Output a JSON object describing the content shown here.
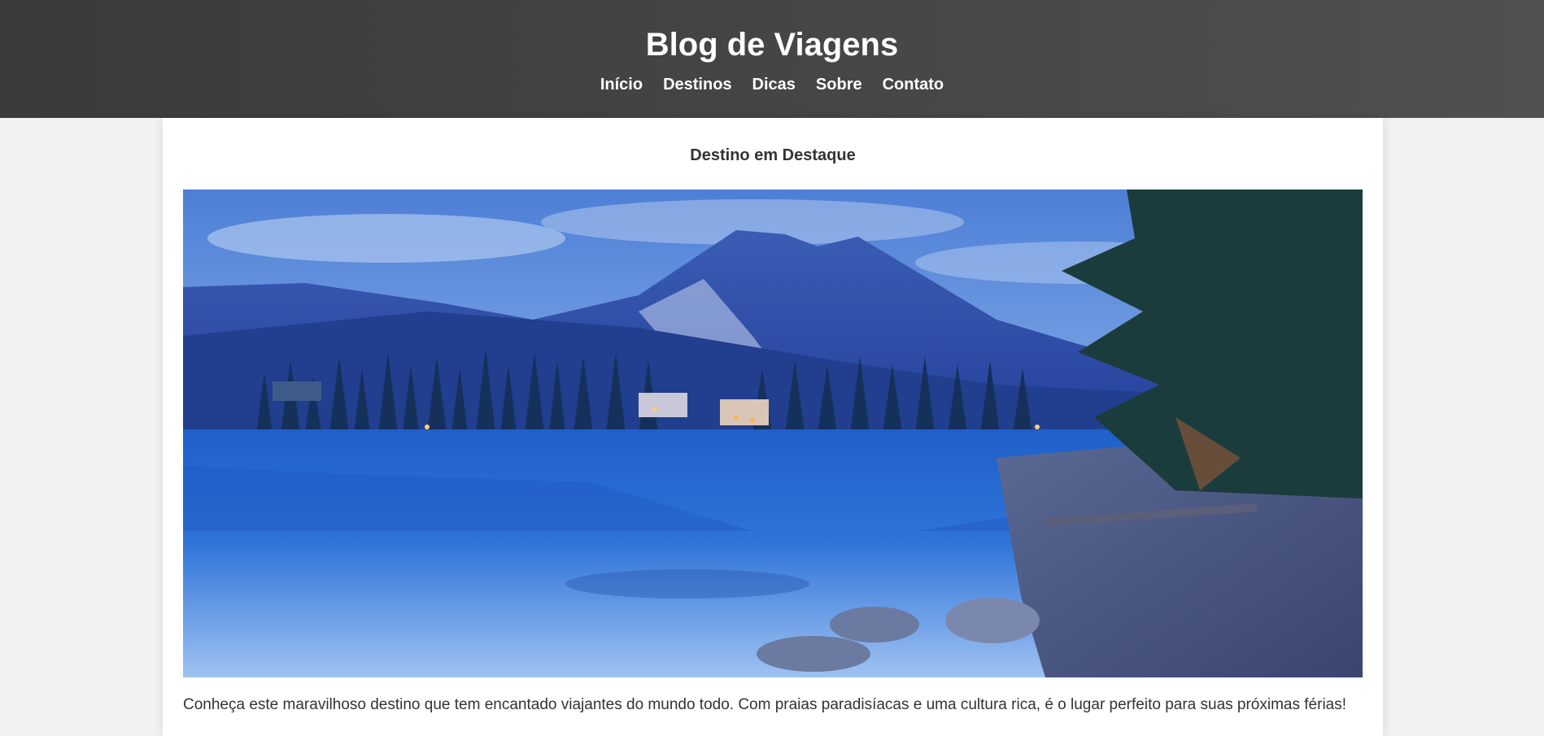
{
  "header": {
    "title": "Blog de Viagens",
    "nav": [
      {
        "label": "Início"
      },
      {
        "label": "Destinos"
      },
      {
        "label": "Dicas"
      },
      {
        "label": "Sobre"
      },
      {
        "label": "Contato"
      }
    ]
  },
  "featured": {
    "heading": "Destino em Destaque",
    "description": "Conheça este maravilhoso destino que tem encantado viajantes do mundo todo. Com praias paradisíacas e uma cultura rica, é o lugar perfeito para suas próximas férias!"
  }
}
